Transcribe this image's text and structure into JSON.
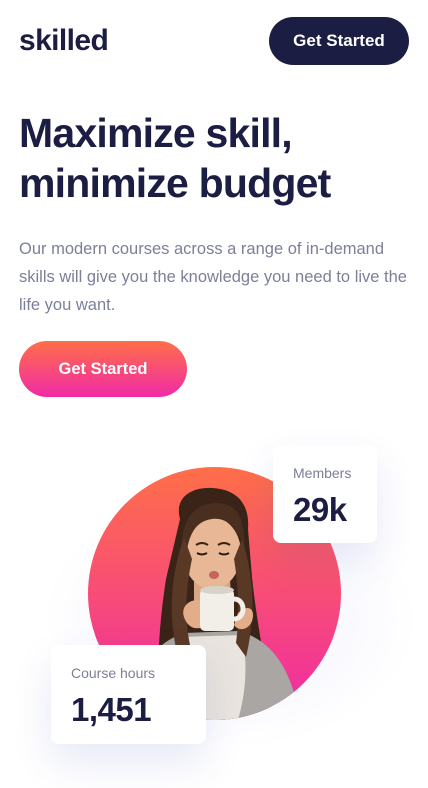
{
  "header": {
    "logo": "skilled",
    "cta_label": "Get Started"
  },
  "hero": {
    "headline_line1": "Maximize skill,",
    "headline_line2": "minimize budget",
    "description": "Our modern courses across a range of in-demand skills will give you the knowledge you need to live the life you want.",
    "cta_label": "Get Started"
  },
  "stats": {
    "members": {
      "label": "Members",
      "value": "29k"
    },
    "course_hours": {
      "label": "Course hours",
      "value": "1,451"
    }
  },
  "colors": {
    "navy": "#1b1e42",
    "gradient_start": "#ff6f48",
    "gradient_end": "#f02aa6",
    "muted_text": "#7c7f98"
  },
  "icons": {
    "hero_image": "woman-drinking-coffee-image"
  }
}
